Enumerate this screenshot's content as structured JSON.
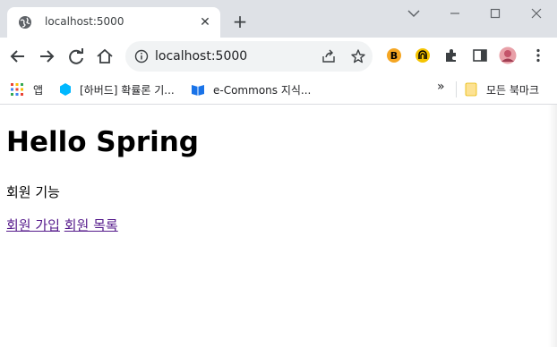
{
  "tab": {
    "title": "localhost:5000",
    "close": "✕"
  },
  "newtab": "+",
  "omnibox": {
    "url": "localhost:5000"
  },
  "bookmarks": [
    {
      "label": "앱",
      "icon": "apps-grid-icon"
    },
    {
      "label": "[하버드] 확률론 기...",
      "icon": "edwith-icon"
    },
    {
      "label": "e-Commons 지식...",
      "icon": "book-icon"
    }
  ],
  "bookmarks_overflow": "»",
  "all_bookmarks": "모든 북마크",
  "page": {
    "title": "Hello Spring",
    "subtitle": "회원 기능",
    "links": [
      "회원 가입",
      "회원 목록"
    ]
  }
}
